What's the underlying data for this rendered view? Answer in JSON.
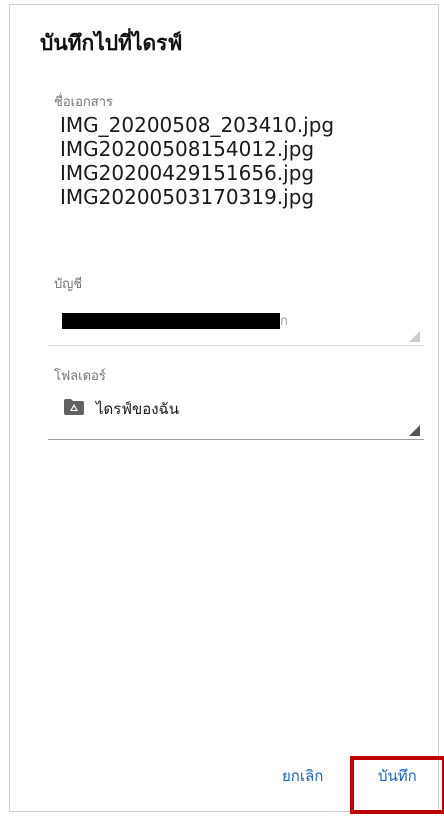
{
  "dialog": {
    "title": "บันทึกไปที่ไดรฟ์",
    "document_label": "ชื่อเอกสาร",
    "documents": [
      "IMG_20200508_203410.jpg",
      "IMG20200508154012.jpg",
      "IMG20200429151656.jpg",
      "IMG20200503170319.jpg"
    ],
    "account_label": "บัญชี",
    "account_value_visible_tail": "ก",
    "folder_label": "โฟลเดอร์",
    "folder_value": "ไดรฟ์ของฉัน",
    "folder_icon": "drive-folder-icon"
  },
  "actions": {
    "cancel_label": "ยกเลิก",
    "save_label": "บันทึก"
  },
  "colors": {
    "accent": "#1565c0",
    "highlight": "#c00000"
  }
}
